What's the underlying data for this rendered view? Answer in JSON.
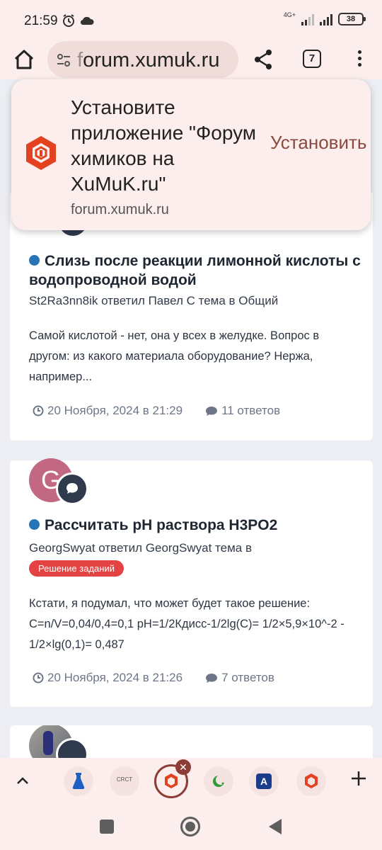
{
  "status_bar": {
    "time": "21:59",
    "network_label": "4G+",
    "battery": "38"
  },
  "browser": {
    "url_prefix": "f",
    "url_rest": "orum.xumuk.ru",
    "tab_count": "7"
  },
  "install_popup": {
    "title": "Установите приложение \"Форум химиков на XuMuK.ru\"",
    "domain": "forum.xumuk.ru",
    "install_label": "Установить",
    "accent_color": "#8a4a40"
  },
  "topics": [
    {
      "title": "Слизь после реакции лимонной кислоты с водопроводной водой",
      "meta": "St2Ra3nn8ik ответил Павел С тема в Общий",
      "excerpt": "Самой кислотой - нет, она у всех в желудке. Вопрос в другом: из какого материала оборудование? Нержа, например...",
      "date": "20 Ноября, 2024 в 21:29",
      "replies": "11 ответов"
    },
    {
      "avatar_letter": "G",
      "avatar_color": "#c26882",
      "title": "Рассчитать pH раствора H3PO2",
      "meta": "GeorgSwyat ответил GeorgSwyat тема в",
      "tag": "Решение заданий",
      "tag_color": "#e34343",
      "excerpt": "Кстати, я подумал, что может будет такое решение: C=n/V=0,04/0,4=0,1 pH=1/2Кдисс-1/2lg(C)= 1/2×5,9×10^-2 - 1/2×lg(0,1)= 0,487",
      "date": "20 Ноября, 2024 в 21:26",
      "replies": "7 ответов"
    }
  ],
  "tab_strip": {
    "tab_icons": [
      "flask-icon",
      "crct-icon",
      "xumuk-icon",
      "crescent-icon",
      "translate-icon",
      "xumuk-icon"
    ],
    "crct_label": "CRCT",
    "translate_label": "A"
  }
}
